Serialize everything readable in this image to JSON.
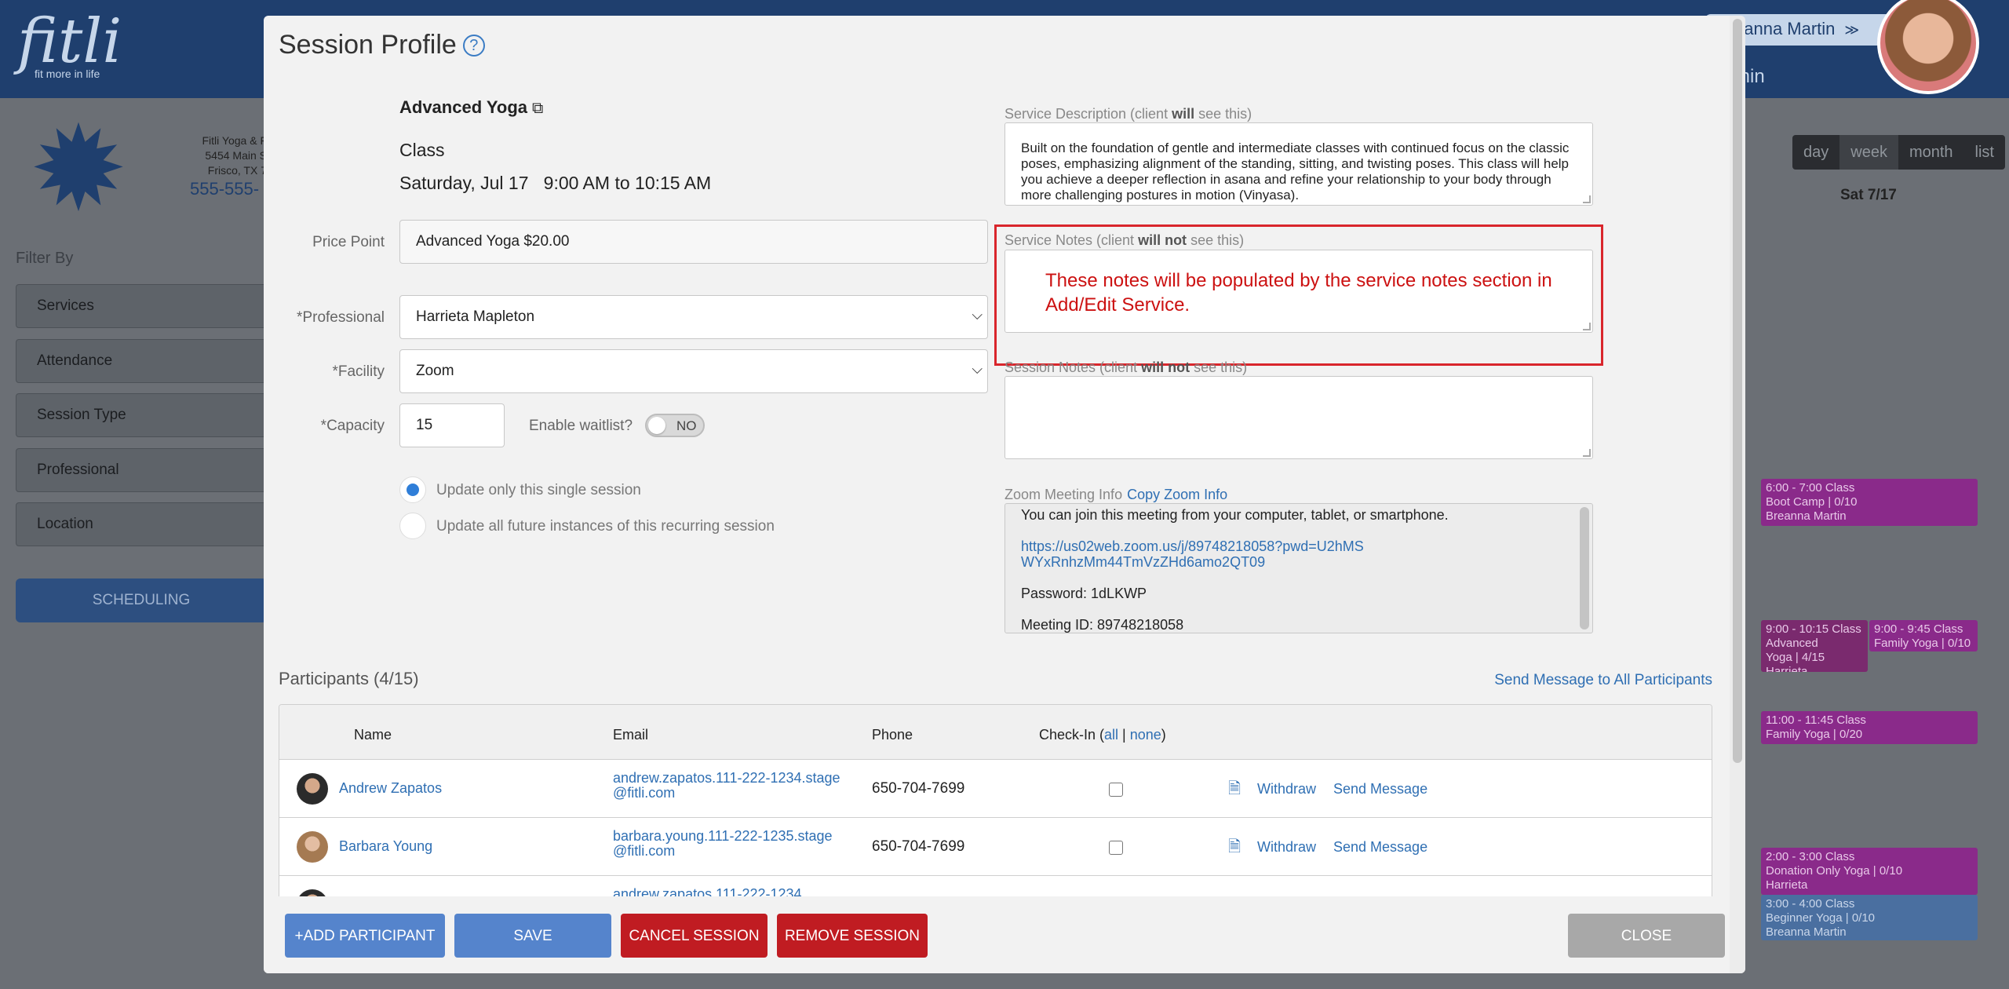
{
  "background": {
    "logo": "fitli",
    "logo_tag": "fit more in life",
    "user_name": "eanna Martin",
    "user_role": "min",
    "studio_lines": [
      "Fitli Yoga & F",
      "5454 Main S",
      "Frisco, TX 7"
    ],
    "studio_phone": "555-555-",
    "filter_label": "Filter By",
    "filters": [
      "Services",
      "Attendance",
      "Session Type",
      "Professional",
      "Location"
    ],
    "scheduling_button": "SCHEDULING",
    "views": [
      "day",
      "week",
      "month",
      "list"
    ],
    "column_head": "Sat 7/17",
    "events": [
      {
        "time": "6:00 - 7:00",
        "kind": "Class",
        "line1": "Boot Camp | 0/10",
        "line2": "Breanna Martin"
      },
      {
        "time": "9:00 - 10:15",
        "kind": "Class",
        "line1": "Advanced",
        "line2": "Yoga | 4/15",
        "line3": "Harrieta"
      },
      {
        "time": "9:00 - 9:45",
        "kind": "Class",
        "line1": "Family Yoga | 0/10"
      },
      {
        "time": "11:00 - 11:45",
        "kind": "Class",
        "line1": "Family Yoga | 0/20"
      },
      {
        "time": "2:00 - 3:00",
        "kind": "Class",
        "line1": "Donation Only Yoga | 0/10",
        "line2": "Harrieta"
      },
      {
        "time": "3:00 - 4:00",
        "kind": "Class",
        "line1": "Beginner Yoga | 0/10",
        "line2": "Breanna Martin"
      }
    ],
    "colors": {
      "header": "#1f3f6e",
      "event_purple": "#8a2a8a",
      "event_blue": "#4a6fa0"
    }
  },
  "modal": {
    "title": "Session Profile",
    "service_name": "Advanced Yoga",
    "service_type": "Class",
    "session_date": "Saturday, Jul 17   9:00 AM to 10:15 AM",
    "price_point": {
      "label": "Price Point",
      "value": "Advanced Yoga $20.00"
    },
    "professional": {
      "label": "*Professional",
      "value": "Harrieta Mapleton"
    },
    "facility": {
      "label": "*Facility",
      "value": "Zoom"
    },
    "capacity": {
      "label": "*Capacity",
      "value": "15"
    },
    "waitlist": {
      "label": "Enable waitlist?",
      "state": "NO"
    },
    "update_options": [
      {
        "label": "Update only this single session",
        "selected": true
      },
      {
        "label": "Update all future instances of this recurring session",
        "selected": false
      }
    ],
    "service_description": {
      "label_pre": "Service Description (client ",
      "label_bold": "will",
      "label_post": " see this)",
      "text": "Built on the foundation of gentle and intermediate classes with continued focus on the classic poses, emphasizing alignment of the standing, sitting, and twisting poses. This class will help you achieve a deeper reflection in asana and refine your relationship to your body through more challenging postures in motion (Vinyasa)."
    },
    "service_notes": {
      "label_pre": "Service Notes (client ",
      "label_bold": "will not",
      "label_post": " see this)"
    },
    "callout_text": "These notes will be populated by the service notes section in Add/Edit Service.",
    "session_notes": {
      "label_pre": "Session Notes (client ",
      "label_bold": "will not",
      "label_post": " see this)"
    },
    "zoom": {
      "label": "Zoom Meeting Info",
      "copy_link": "Copy Zoom Info",
      "intro": "You can join this meeting from your computer, tablet, or smartphone.",
      "url": "https://us02web.zoom.us/j/89748218058?pwd=U2hMSWYxRnhzMm44TmVzZHd6amo2QT09",
      "password": "Password: 1dLKWP",
      "meeting_id": "Meeting ID: 89748218058"
    },
    "participants": {
      "title": "Participants (4/15)",
      "send_all": "Send Message to All Participants",
      "headers": {
        "name": "Name",
        "email": "Email",
        "phone": "Phone",
        "checkin": "Check-In",
        "all": "all",
        "none": "none"
      },
      "rows": [
        {
          "name": "Andrew Zapatos",
          "email": "andrew.zapatos.111-222-1234.stage@fitli.com",
          "phone": "650-704-7699",
          "withdraw": "Withdraw",
          "send": "Send Message"
        },
        {
          "name": "Barbara Young",
          "email": "barbara.young.111-222-1235.stage@fitli.com",
          "phone": "650-704-7699",
          "withdraw": "Withdraw",
          "send": "Send Message"
        },
        {
          "name": "",
          "email": "andrew.zapatos.111-222-1234",
          "phone": "",
          "withdraw": "",
          "send": ""
        }
      ]
    },
    "buttons": {
      "add_participant": "+ADD PARTICIPANT",
      "save": "SAVE",
      "cancel_session": "CANCEL SESSION",
      "remove_session": "REMOVE SESSION",
      "close": "CLOSE"
    },
    "colors": {
      "primary": "#5584cc",
      "danger": "#c01c22",
      "callout": "#d9262c",
      "link": "#2f6fb3"
    }
  }
}
